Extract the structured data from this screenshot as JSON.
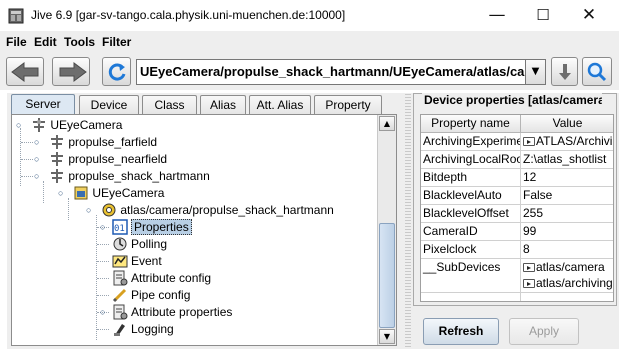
{
  "window": {
    "title": "Jive 6.9 [gar-sv-tango.cala.physik.uni-muenchen.de:10000]",
    "minimize": "—",
    "maximize": "☐",
    "close": "✕",
    "app_icon": "jive-app-icon"
  },
  "menu": [
    "File",
    "Edit",
    "Tools",
    "Filter"
  ],
  "toolbar": {
    "back_icon": "back-arrow-icon",
    "forward_icon": "forward-arrow-icon",
    "refresh_icon": "refresh-icon",
    "path": "UEyeCamera/propulse_shack_hartmann/UEyeCamera/atlas/camera/propulse_shack_hartmann",
    "dropdown_icon": "▼",
    "go_icon": "down-arrow-icon",
    "search_icon": "search-icon"
  },
  "tabs": [
    "Server",
    "Device",
    "Class",
    "Alias",
    "Att. Alias",
    "Property"
  ],
  "tree": [
    {
      "label": "UEyeCamera",
      "icon": "server-icon",
      "handle": "expanded"
    },
    {
      "label": "propulse_farfield",
      "icon": "server-instance-icon",
      "handle": "collapsed"
    },
    {
      "label": "propulse_nearfield",
      "icon": "server-instance-icon",
      "handle": "collapsed"
    },
    {
      "label": "propulse_shack_hartmann",
      "icon": "server-instance-icon",
      "handle": "expanded"
    },
    {
      "label": "UEyeCamera",
      "icon": "class-icon",
      "handle": "expanded"
    },
    {
      "label": "atlas/camera/propulse_shack_hartmann",
      "icon": "device-icon",
      "handle": "expanded"
    },
    {
      "label": "Properties",
      "icon": "properties-icon",
      "handle": "collapsed"
    },
    {
      "label": "Polling",
      "icon": "polling-icon",
      "handle": "none"
    },
    {
      "label": "Event",
      "icon": "event-icon",
      "handle": "none"
    },
    {
      "label": "Attribute config",
      "icon": "attribute-config-icon",
      "handle": "none"
    },
    {
      "label": "Pipe config",
      "icon": "pipe-config-icon",
      "handle": "none"
    },
    {
      "label": "Attribute properties",
      "icon": "attribute-properties-icon",
      "handle": "collapsed"
    },
    {
      "label": "Logging",
      "icon": "logging-icon",
      "handle": "none"
    }
  ],
  "properties": {
    "title": "Device properties [atlas/camera/propulse_shack_hartmann]",
    "columns": [
      "Property name",
      "Value"
    ],
    "rows": [
      {
        "name": "ArchivingExperiment",
        "value": "ATLAS/Archiving",
        "has_button": true
      },
      {
        "name": "ArchivingLocalRoot",
        "value": "Z:\\atlas_shotlist",
        "has_button": false
      },
      {
        "name": "Bitdepth",
        "value": "12",
        "has_button": false
      },
      {
        "name": "BlacklevelAuto",
        "value": "False",
        "has_button": false
      },
      {
        "name": "BlacklevelOffset",
        "value": "255",
        "has_button": false
      },
      {
        "name": "CameraID",
        "value": "99",
        "has_button": false
      },
      {
        "name": "Pixelclock",
        "value": "8",
        "has_button": false
      },
      {
        "name": "__SubDevices",
        "value": "atlas/camera",
        "has_button": true,
        "extra_value": "atlas/archiving"
      }
    ],
    "refresh_label": "Refresh",
    "apply_label": "Apply"
  }
}
